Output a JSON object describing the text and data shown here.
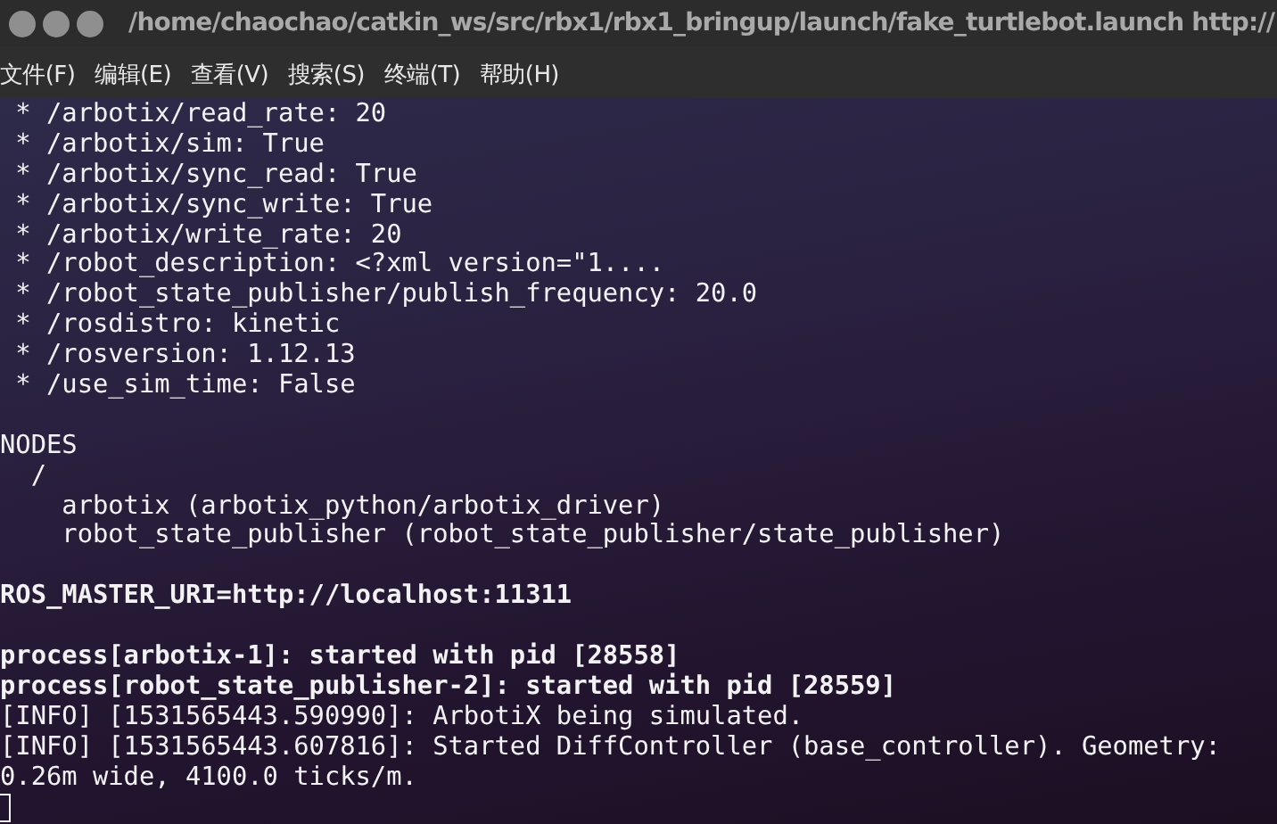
{
  "window": {
    "title": "/home/chaochao/catkin_ws/src/rbx1/rbx1_bringup/launch/fake_turtlebot.launch http://"
  },
  "menu": [
    "文件(F)",
    "编辑(E)",
    "查看(V)",
    "搜索(S)",
    "终端(T)",
    "帮助(H)"
  ],
  "terminal": {
    "lines": [
      {
        "kind": "text",
        "text": " * /arbotix/read_rate: 20"
      },
      {
        "kind": "text",
        "text": " * /arbotix/sim: True"
      },
      {
        "kind": "text",
        "text": " * /arbotix/sync_read: True"
      },
      {
        "kind": "text",
        "text": " * /arbotix/sync_write: True"
      },
      {
        "kind": "text",
        "text": " * /arbotix/write_rate: 20"
      },
      {
        "kind": "text",
        "text": " * /robot_description: <?xml version=\"1...."
      },
      {
        "kind": "text",
        "text": " * /robot_state_publisher/publish_frequency: 20.0"
      },
      {
        "kind": "text",
        "text": " * /rosdistro: kinetic"
      },
      {
        "kind": "text",
        "text": " * /rosversion: 1.12.13"
      },
      {
        "kind": "text",
        "text": " * /use_sim_time: False"
      },
      {
        "kind": "blank"
      },
      {
        "kind": "text",
        "text": "NODES"
      },
      {
        "kind": "text",
        "text": "  /"
      },
      {
        "kind": "text",
        "text": "    arbotix (arbotix_python/arbotix_driver)"
      },
      {
        "kind": "text",
        "text": "    robot_state_publisher (robot_state_publisher/state_publisher)"
      },
      {
        "kind": "blank"
      },
      {
        "kind": "bold",
        "text": "ROS_MASTER_URI=http://localhost:11311"
      },
      {
        "kind": "blank"
      },
      {
        "kind": "bold",
        "text": "process[arbotix-1]: started with pid [28558]"
      },
      {
        "kind": "bold",
        "text": "process[robot_state_publisher-2]: started with pid [28559]"
      },
      {
        "kind": "text",
        "text": "[INFO] [1531565443.590990]: ArbotiX being simulated."
      },
      {
        "kind": "text",
        "text": "[INFO] [1531565443.607816]: Started DiffController (base_controller). Geometry:"
      },
      {
        "kind": "text",
        "text": "0.26m wide, 4100.0 ticks/m."
      },
      {
        "kind": "cursor"
      }
    ]
  }
}
